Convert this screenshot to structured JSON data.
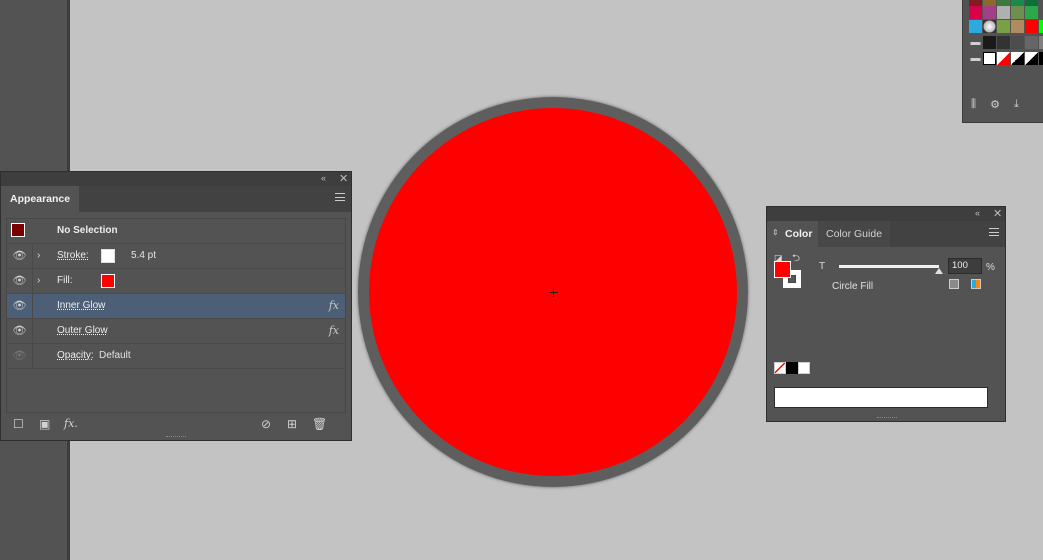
{
  "appearance": {
    "tab_label": "Appearance",
    "collapse_label": "«",
    "close_label": "✕",
    "header": "No Selection",
    "rows": [
      {
        "label": "Stroke:",
        "value": "5.4 pt",
        "swatch": "#ffffff"
      },
      {
        "label": "Fill:",
        "swatch": "#ff0000"
      },
      {
        "label": "Inner Glow",
        "fx": "fx"
      },
      {
        "label": "Outer Glow",
        "fx": "fx"
      },
      {
        "label": "Opacity:",
        "value": "Default"
      }
    ],
    "footer": {
      "fx_label": "fx."
    },
    "colors": {
      "panel_bg": "#535353",
      "selected_row": "#4c5f77"
    }
  },
  "color_panel": {
    "tabs": [
      "Color",
      "Color Guide"
    ],
    "slider_label": "T",
    "tint_value": "100",
    "tint_unit": "%",
    "swatch_name": "Circle Fill",
    "fill_color": "#ff0000",
    "stroke_color": "#ffffff"
  },
  "canvas": {
    "artwork_fill": "#ff0000",
    "artwork_stroke": "#5a5a5a",
    "background": "#c3c3c3"
  },
  "swatches_panel": {
    "rows": [
      [
        "#8a1f2c",
        "#d6004b",
        "#a33f86",
        "#ff00ff",
        "#00a651",
        "#0b7a3e"
      ],
      [
        "#29abe2",
        "#b3b3b3",
        "#79a044",
        "#c8a070",
        "#ff0000",
        "#00ff00"
      ],
      [
        "#1a1a1a",
        "#333333",
        "#4d4d4d",
        "#666666",
        "#808080"
      ],
      [
        "#ffffff",
        "#ff0000",
        "#000000",
        "#000000",
        "#000000"
      ]
    ]
  }
}
